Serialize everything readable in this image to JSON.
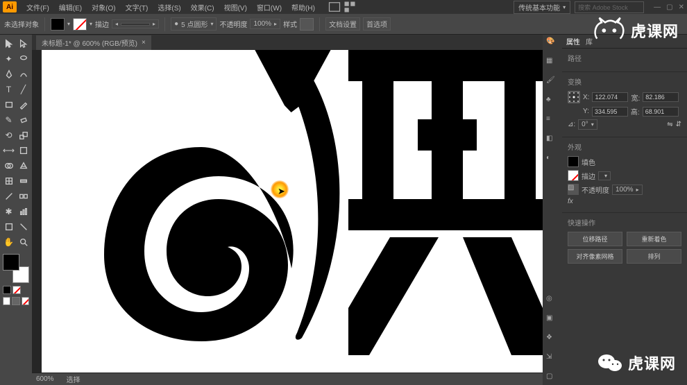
{
  "app": {
    "logo": "Ai"
  },
  "menu": [
    "文件(F)",
    "编辑(E)",
    "对象(O)",
    "文字(T)",
    "选择(S)",
    "效果(C)",
    "视图(V)",
    "窗口(W)",
    "帮助(H)"
  ],
  "workspace": "传统基本功能",
  "search_placeholder": "搜索 Adobe Stock",
  "control": {
    "no_selection": "未选择对象",
    "stroke_label": "描边",
    "stroke_width": "",
    "stroke_style": "5 点圆形",
    "opacity_label": "不透明度",
    "opacity_value": "100%",
    "style_label": "样式",
    "doc_setup": "文档设置",
    "prefs": "首选项"
  },
  "doc_tab": "未标题-1* @ 600% (RGB/预览)",
  "tab_close": "×",
  "properties": {
    "tab1": "属性",
    "tab2": "库",
    "section1_title": "路径",
    "transform_title": "变换",
    "x_label": "X:",
    "x_val": "122.074",
    "w_label": "宽:",
    "w_val": "82.186",
    "y_label": "Y:",
    "y_val": "334.595",
    "h_label": "高:",
    "h_val": "68.901",
    "angle_label": "⊿:",
    "angle_val": "0°",
    "appearance_title": "外观",
    "fill_label": "填色",
    "stroke_label": "描边",
    "opacity_label": "不透明度",
    "opacity_val": "100%",
    "fx_label": "fx",
    "quick_title": "快速操作",
    "btn1": "位移路径",
    "btn2": "重新着色",
    "btn3": "对齐像素网格",
    "btn4": "排列"
  },
  "status": {
    "zoom": "600%",
    "label": "选择"
  },
  "watermark": "虎课网",
  "wm_bottom": "虎课网"
}
